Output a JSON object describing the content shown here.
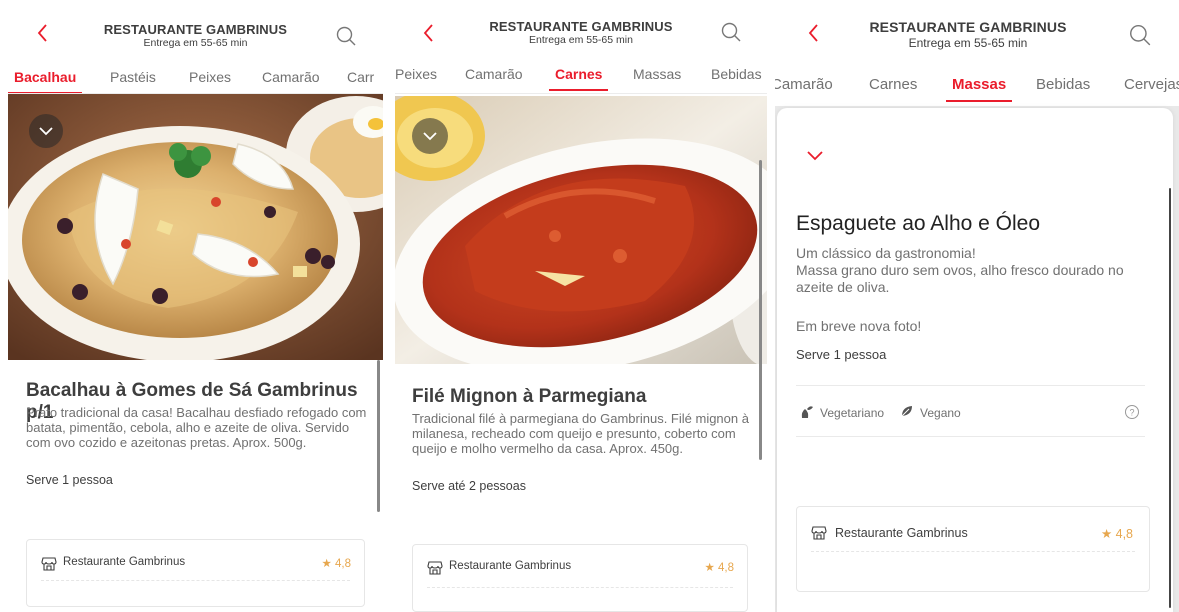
{
  "header": {
    "title": "RESTAURANTE GAMBRINUS",
    "subtitle": "Entrega em 55-65 min",
    "back_icon": "chevron-left-icon",
    "search_icon": "search-icon"
  },
  "colors": {
    "accent": "#ea1d2c",
    "text": "#3e3e3e",
    "muted": "#717171",
    "star": "#e7a74e"
  },
  "panel1": {
    "tabs": [
      "Bacalhau",
      "Pastéis",
      "Peixes",
      "Camarão",
      "Carr"
    ],
    "active_tab": "Bacalhau",
    "dish": {
      "title": "Bacalhau à Gomes de Sá Gambrinus p/1",
      "description": "Prato tradicional da casa! Bacalhau desfiado refogado com batata, pimentão, cebola, alho e azeite de oliva. Servido com ovo cozido e azeitonas pretas. Aprox. 500g.",
      "serves": "Serve 1 pessoa"
    },
    "store": {
      "name": "Restaurante Gambrinus",
      "rating": "★ 4,8"
    }
  },
  "panel2": {
    "tabs": [
      "Peixes",
      "Camarão",
      "Carnes",
      "Massas",
      "Bebidas"
    ],
    "active_tab": "Carnes",
    "dish": {
      "title": "Filé Mignon à Parmegiana",
      "description": "Tradicional filé à parmegiana do Gambrinus. Filé mignon à milanesa, recheado com queijo e presunto, coberto com queijo e molho vermelho da casa. Aprox. 450g.",
      "serves": "Serve até 2 pessoas"
    },
    "store": {
      "name": "Restaurante Gambrinus",
      "rating": "★ 4,8"
    }
  },
  "panel3": {
    "tabs": [
      "Camarão",
      "Carnes",
      "Massas",
      "Bebidas",
      "Cervejas"
    ],
    "active_tab": "Massas",
    "dish": {
      "title": "Espaguete ao Alho e Óleo",
      "description_1": "Um clássico da gastronomia!",
      "description_2": "Massa grano duro sem ovos, alho fresco dourado no azeite de oliva.",
      "description_3": "Em breve nova foto!",
      "serves": "Serve 1 pessoa"
    },
    "tags": [
      {
        "label": "Vegetariano",
        "icon": "vegetarian-icon"
      },
      {
        "label": "Vegano",
        "icon": "vegan-leaf-icon"
      }
    ],
    "help_icon": "help-icon",
    "store": {
      "name": "Restaurante Gambrinus",
      "rating": "★ 4,8"
    }
  }
}
